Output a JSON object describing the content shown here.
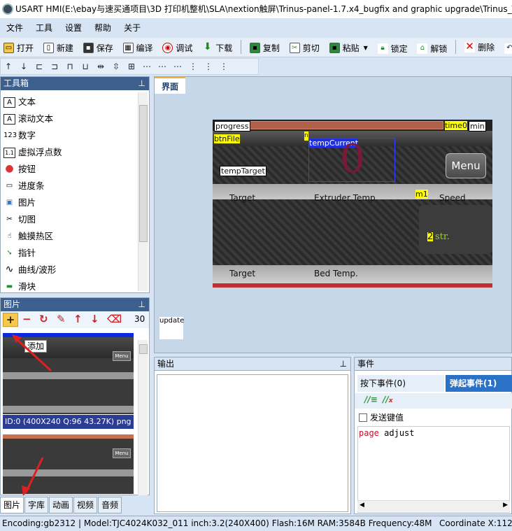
{
  "title": "USART HMI(E:\\ebay与速买通项目\\3D 打印机整机\\SLA\\nextion触屏\\Trinus-panel-1.7.x4_bugfix and graphic upgrade\\Trinus_T",
  "menu": [
    "文件",
    "工具",
    "设置",
    "帮助",
    "关于"
  ],
  "toolbar": {
    "open": "打开",
    "new": "新建",
    "save": "保存",
    "compile": "编译",
    "debug": "调试",
    "download": "下载",
    "copy": "复制",
    "cut": "剪切",
    "paste": "粘贴",
    "lock": "锁定",
    "unlock": "解锁",
    "delete": "删除",
    "undo": "撤销"
  },
  "toolbox": {
    "header": "工具箱",
    "items": [
      {
        "label": "文本",
        "icon": "text-icon",
        "glyph": "A"
      },
      {
        "label": "滚动文本",
        "icon": "scroll-text-icon",
        "glyph": "A"
      },
      {
        "label": "数字",
        "icon": "number-icon",
        "glyph": "123"
      },
      {
        "label": "虚拟浮点数",
        "icon": "float-icon",
        "glyph": "1.1"
      },
      {
        "label": "按钮",
        "icon": "button-icon",
        "glyph": "●"
      },
      {
        "label": "进度条",
        "icon": "progress-icon",
        "glyph": "▭"
      },
      {
        "label": "图片",
        "icon": "picture-icon",
        "glyph": "▣"
      },
      {
        "label": "切图",
        "icon": "crop-icon",
        "glyph": "✂"
      },
      {
        "label": "触摸热区",
        "icon": "touch-icon",
        "glyph": "☝"
      },
      {
        "label": "指针",
        "icon": "pointer-icon",
        "glyph": "➘"
      },
      {
        "label": "曲线/波形",
        "icon": "wave-icon",
        "glyph": "∿"
      },
      {
        "label": "滑块",
        "icon": "slider-icon",
        "glyph": "▬"
      }
    ]
  },
  "pictures": {
    "header": "图片",
    "count": "30",
    "tooltip": "添加",
    "item_info": "ID:0  (400X240 Q:96 43.27K) png"
  },
  "bottom_tabs": [
    "图片",
    "字库",
    "动画",
    "视频",
    "音频"
  ],
  "work": {
    "tab": "界面",
    "screen": {
      "progress": "progress",
      "time": "time",
      "time_value": "0",
      "min": "min",
      "btn_file": "btnFile",
      "n": "n",
      "temp_current": "tempCurrent",
      "big_value": "0",
      "temp_target": "tempTarget",
      "menu_button": "Menu",
      "target1": "Target",
      "extruder_temp": "Extruder Temp.",
      "m1": "m1",
      "speed": "Speed",
      "two": "2",
      "str": "str.",
      "target2": "Target",
      "bed_temp": "Bed Temp."
    },
    "update": "update"
  },
  "output": {
    "header": "输出"
  },
  "events": {
    "header": "事件",
    "tab_press": "按下事件(0)",
    "tab_release": "弹起事件(1)",
    "send_key": "发送键值",
    "code_keyword": "page",
    "code_arg": "adjust"
  },
  "status": {
    "encoding": "Encoding:gb2312",
    "model": "Model:TJC4024K032_011",
    "inch": "inch:3.2(240X400)",
    "flash": "Flash:16M",
    "ram": "RAM:3584B",
    "frequency": "Frequency:48M",
    "coordinate": "Coordinate X:112"
  }
}
